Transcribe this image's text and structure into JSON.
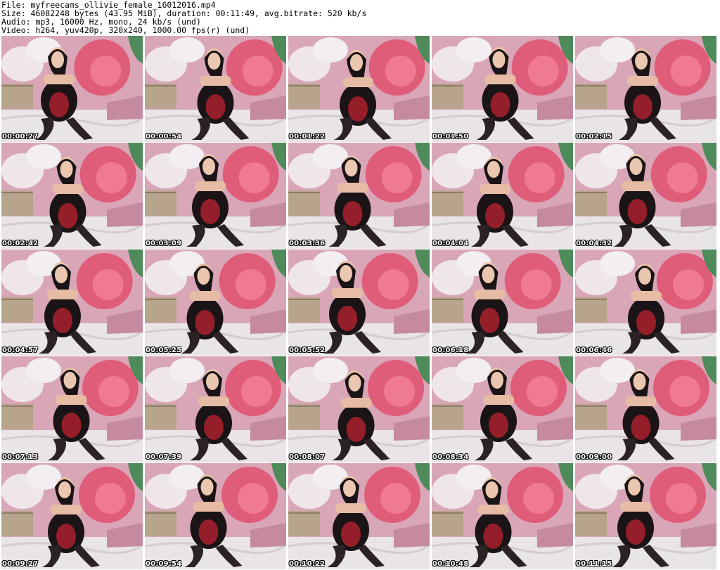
{
  "header": {
    "file_line": "File: myfreecams_ollivie_female_16012016.mp4",
    "size_line": "Size: 46082248 bytes (43.95 MiB), duration: 00:11:49, avg.bitrate: 520 kb/s",
    "audio_line": "Audio: mp3, 16000 Hz, mono, 24 kb/s (und)",
    "video_line": "Video: h264, yuv420p, 320x240, 1000.00 fps(r) (und)"
  },
  "thumbnails": [
    {
      "timestamp": "00:00:27"
    },
    {
      "timestamp": "00:00:54"
    },
    {
      "timestamp": "00:01:22"
    },
    {
      "timestamp": "00:01:50"
    },
    {
      "timestamp": "00:02:15"
    },
    {
      "timestamp": "00:02:42"
    },
    {
      "timestamp": "00:03:09"
    },
    {
      "timestamp": "00:03:36"
    },
    {
      "timestamp": "00:04:04"
    },
    {
      "timestamp": "00:04:32"
    },
    {
      "timestamp": "00:04:57"
    },
    {
      "timestamp": "00:05:25"
    },
    {
      "timestamp": "00:05:52"
    },
    {
      "timestamp": "00:06:18"
    },
    {
      "timestamp": "00:06:46"
    },
    {
      "timestamp": "00:07:13"
    },
    {
      "timestamp": "00:07:39"
    },
    {
      "timestamp": "00:08:07"
    },
    {
      "timestamp": "00:08:34"
    },
    {
      "timestamp": "00:09:00"
    },
    {
      "timestamp": "00:09:27"
    },
    {
      "timestamp": "00:09:54"
    },
    {
      "timestamp": "00:10:22"
    },
    {
      "timestamp": "00:10:48"
    },
    {
      "timestamp": "00:11:15"
    }
  ],
  "colors": {
    "background": "#ffffff",
    "header_text": "#000000",
    "timestamp_text": "#ffffff",
    "timestamp_outline": "#000000",
    "wall_pink": "#d9a6b8",
    "rose_red": "#e0506e",
    "bedsheet": "#e9e4e6",
    "lingerie_red": "#b3202e",
    "lingerie_black": "#1a1416"
  }
}
